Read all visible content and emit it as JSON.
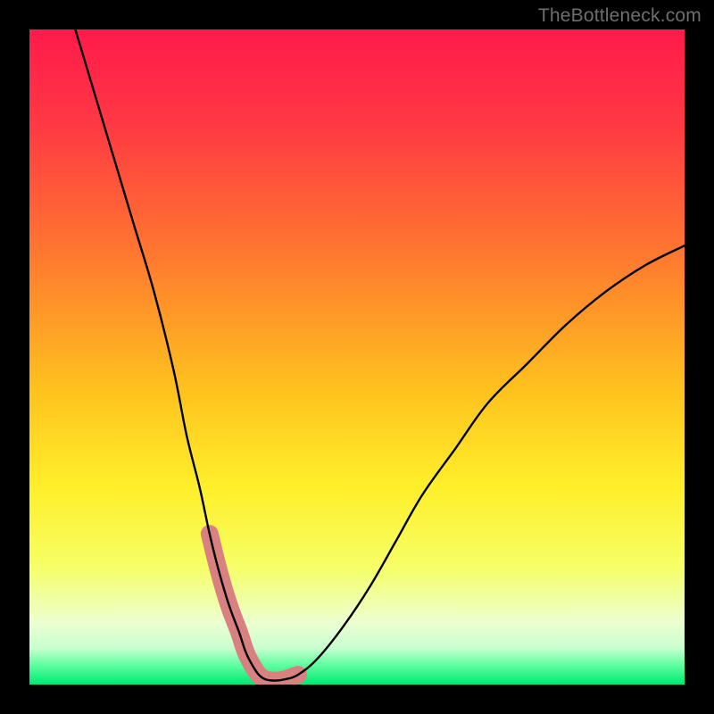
{
  "watermark": "TheBottleneck.com",
  "chart_data": {
    "type": "line",
    "title": "",
    "xlabel": "",
    "ylabel": "",
    "xlim": [
      0,
      100
    ],
    "ylim": [
      0,
      100
    ],
    "grid": false,
    "legend": false,
    "gradient_stops": [
      {
        "pos": 0.0,
        "color": "#ff1a4b"
      },
      {
        "pos": 0.15,
        "color": "#ff3a43"
      },
      {
        "pos": 0.35,
        "color": "#ff7a2f"
      },
      {
        "pos": 0.55,
        "color": "#ffc21e"
      },
      {
        "pos": 0.7,
        "color": "#ffef2a"
      },
      {
        "pos": 0.82,
        "color": "#f6ff66"
      },
      {
        "pos": 0.905,
        "color": "#ecffd0"
      },
      {
        "pos": 0.945,
        "color": "#c8ffd0"
      },
      {
        "pos": 0.97,
        "color": "#5fffa0"
      },
      {
        "pos": 1.0,
        "color": "#00e874"
      }
    ],
    "series": [
      {
        "name": "bottleneck-curve",
        "color": "#000000",
        "x": [
          7,
          10,
          13,
          16,
          19,
          22,
          24,
          26,
          27.5,
          29,
          30.5,
          32,
          33,
          34,
          35,
          36,
          37.5,
          39,
          41,
          44,
          48,
          52,
          56,
          60,
          65,
          70,
          76,
          82,
          88,
          94,
          100
        ],
        "y": [
          100,
          90,
          80,
          70,
          60,
          48,
          38,
          30,
          23,
          17,
          12,
          8,
          5,
          3,
          1.5,
          0.8,
          0.6,
          0.8,
          1.5,
          4,
          9,
          15,
          22,
          29,
          36,
          43,
          49,
          55,
          60,
          64,
          67
        ],
        "note": "y is approximate bottleneck percentage read from vertical position; minimum near x≈37"
      }
    ],
    "overlay_segment": {
      "name": "highlight-band",
      "color": "#d98080",
      "x_range": [
        27.5,
        42
      ],
      "note": "salmon thick band overlaid on the curve near the trough"
    }
  }
}
